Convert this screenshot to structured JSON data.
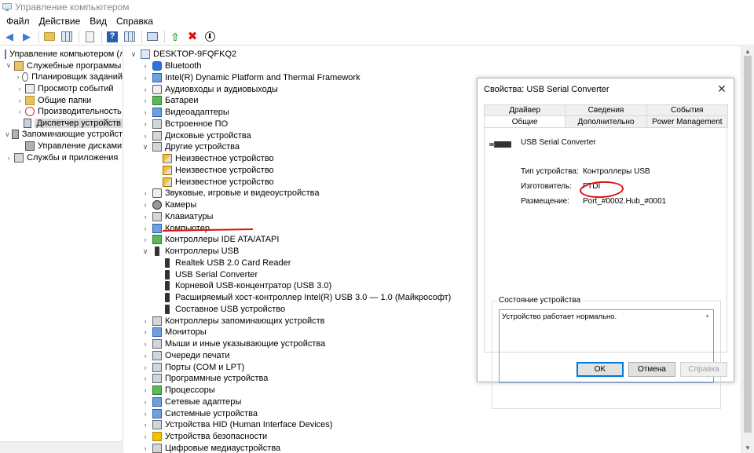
{
  "window": {
    "title": "Управление компьютером"
  },
  "menu": [
    "Файл",
    "Действие",
    "Вид",
    "Справка"
  ],
  "left_tree": [
    {
      "label": "Управление компьютером (л",
      "expand": "",
      "level": 0,
      "icon": "computer-management-icon"
    },
    {
      "label": "Служебные программы",
      "expand": "v",
      "level": 1,
      "icon": "tools-icon"
    },
    {
      "label": "Планировщик заданий",
      "expand": ">",
      "level": 2,
      "icon": "clock-icon"
    },
    {
      "label": "Просмотр событий",
      "expand": ">",
      "level": 2,
      "icon": "event-log-icon"
    },
    {
      "label": "Общие папки",
      "expand": ">",
      "level": 2,
      "icon": "shared-folder-icon"
    },
    {
      "label": "Производительность",
      "expand": ">",
      "level": 2,
      "icon": "performance-icon"
    },
    {
      "label": "Диспетчер устройств",
      "expand": "",
      "level": 2,
      "icon": "device-manager-icon",
      "selected": true
    },
    {
      "label": "Запоминающие устройст",
      "expand": "v",
      "level": 1,
      "icon": "storage-icon"
    },
    {
      "label": "Управление дисками",
      "expand": "",
      "level": 2,
      "icon": "disk-icon"
    },
    {
      "label": "Службы и приложения",
      "expand": ">",
      "level": 1,
      "icon": "services-icon"
    }
  ],
  "device_tree": [
    {
      "label": "DESKTOP-9FQFKQ2",
      "expand": "v",
      "level": 0,
      "icon": "computer"
    },
    {
      "label": "Bluetooth",
      "expand": ">",
      "level": 1,
      "icon": "bt"
    },
    {
      "label": "Intel(R) Dynamic Platform and Thermal Framework",
      "expand": ">",
      "level": 1,
      "icon": "blue"
    },
    {
      "label": "Аудиовходы и аудиовыходы",
      "expand": ">",
      "level": 1,
      "icon": "speaker"
    },
    {
      "label": "Батареи",
      "expand": ">",
      "level": 1,
      "icon": "green"
    },
    {
      "label": "Видеоадаптеры",
      "expand": ">",
      "level": 1,
      "icon": "blue"
    },
    {
      "label": "Встроенное ПО",
      "expand": ">",
      "level": 1,
      "icon": "gray"
    },
    {
      "label": "Дисковые устройства",
      "expand": ">",
      "level": 1,
      "icon": "gray"
    },
    {
      "label": "Другие устройства",
      "expand": "v",
      "level": 1,
      "icon": "gray"
    },
    {
      "label": "Неизвестное устройство",
      "expand": "",
      "level": 2,
      "icon": "warn"
    },
    {
      "label": "Неизвестное устройство",
      "expand": "",
      "level": 2,
      "icon": "warn"
    },
    {
      "label": "Неизвестное устройство",
      "expand": "",
      "level": 2,
      "icon": "warn"
    },
    {
      "label": "Звуковые, игровые и видеоустройства",
      "expand": ">",
      "level": 1,
      "icon": "speaker"
    },
    {
      "label": "Камеры",
      "expand": ">",
      "level": 1,
      "icon": "cam"
    },
    {
      "label": "Клавиатуры",
      "expand": ">",
      "level": 1,
      "icon": "gray"
    },
    {
      "label": "Компьютер",
      "expand": ">",
      "level": 1,
      "icon": "blue"
    },
    {
      "label": "Контроллеры IDE ATA/ATAPI",
      "expand": ">",
      "level": 1,
      "icon": "green"
    },
    {
      "label": "Контроллеры USB",
      "expand": "v",
      "level": 1,
      "icon": "usb"
    },
    {
      "label": "Realtek USB 2.0 Card Reader",
      "expand": "",
      "level": 2,
      "icon": "usb"
    },
    {
      "label": "USB Serial Converter",
      "expand": "",
      "level": 2,
      "icon": "usb"
    },
    {
      "label": "Корневой USB-концентратор (USB 3.0)",
      "expand": "",
      "level": 2,
      "icon": "usb"
    },
    {
      "label": "Расширяемый хост-контроллер Intel(R) USB 3.0 — 1.0 (Майкрософт)",
      "expand": "",
      "level": 2,
      "icon": "usb"
    },
    {
      "label": "Составное USB устройство",
      "expand": "",
      "level": 2,
      "icon": "usb"
    },
    {
      "label": "Контроллеры запоминающих устройств",
      "expand": ">",
      "level": 1,
      "icon": "gray"
    },
    {
      "label": "Мониторы",
      "expand": ">",
      "level": 1,
      "icon": "blue"
    },
    {
      "label": "Мыши и иные указывающие устройства",
      "expand": ">",
      "level": 1,
      "icon": "gray"
    },
    {
      "label": "Очереди печати",
      "expand": ">",
      "level": 1,
      "icon": "gray"
    },
    {
      "label": "Порты (COM и LPT)",
      "expand": ">",
      "level": 1,
      "icon": "gray"
    },
    {
      "label": "Программные устройства",
      "expand": ">",
      "level": 1,
      "icon": "gray"
    },
    {
      "label": "Процессоры",
      "expand": ">",
      "level": 1,
      "icon": "green"
    },
    {
      "label": "Сетевые адаптеры",
      "expand": ">",
      "level": 1,
      "icon": "blue"
    },
    {
      "label": "Системные устройства",
      "expand": ">",
      "level": 1,
      "icon": "blue"
    },
    {
      "label": "Устройства HID (Human Interface Devices)",
      "expand": ">",
      "level": 1,
      "icon": "gray"
    },
    {
      "label": "Устройства безопасности",
      "expand": ">",
      "level": 1,
      "icon": "yellow"
    },
    {
      "label": "Цифровые медиаустройства",
      "expand": ">",
      "level": 1,
      "icon": "gray"
    }
  ],
  "dialog": {
    "title": "Свойства: USB Serial Converter",
    "tabs_top": [
      "Драйвер",
      "Сведения",
      "События"
    ],
    "tabs_bottom": [
      "Общие",
      "Дополнительно",
      "Power Management"
    ],
    "device_name": "USB Serial Converter",
    "props": [
      {
        "label": "Тип устройства:",
        "value": "Контроллеры USB"
      },
      {
        "label": "Изготовитель:",
        "value": "FTDI"
      },
      {
        "label": "Размещение:",
        "value": "Port_#0002.Hub_#0001"
      }
    ],
    "status_legend": "Состояние устройства",
    "status_text": "Устройство работает нормально.",
    "buttons": {
      "ok": "OK",
      "cancel": "Отмена",
      "help": "Справка"
    }
  },
  "colors": {
    "annotation_red": "#d11111",
    "ok_border": "#0078d7"
  }
}
